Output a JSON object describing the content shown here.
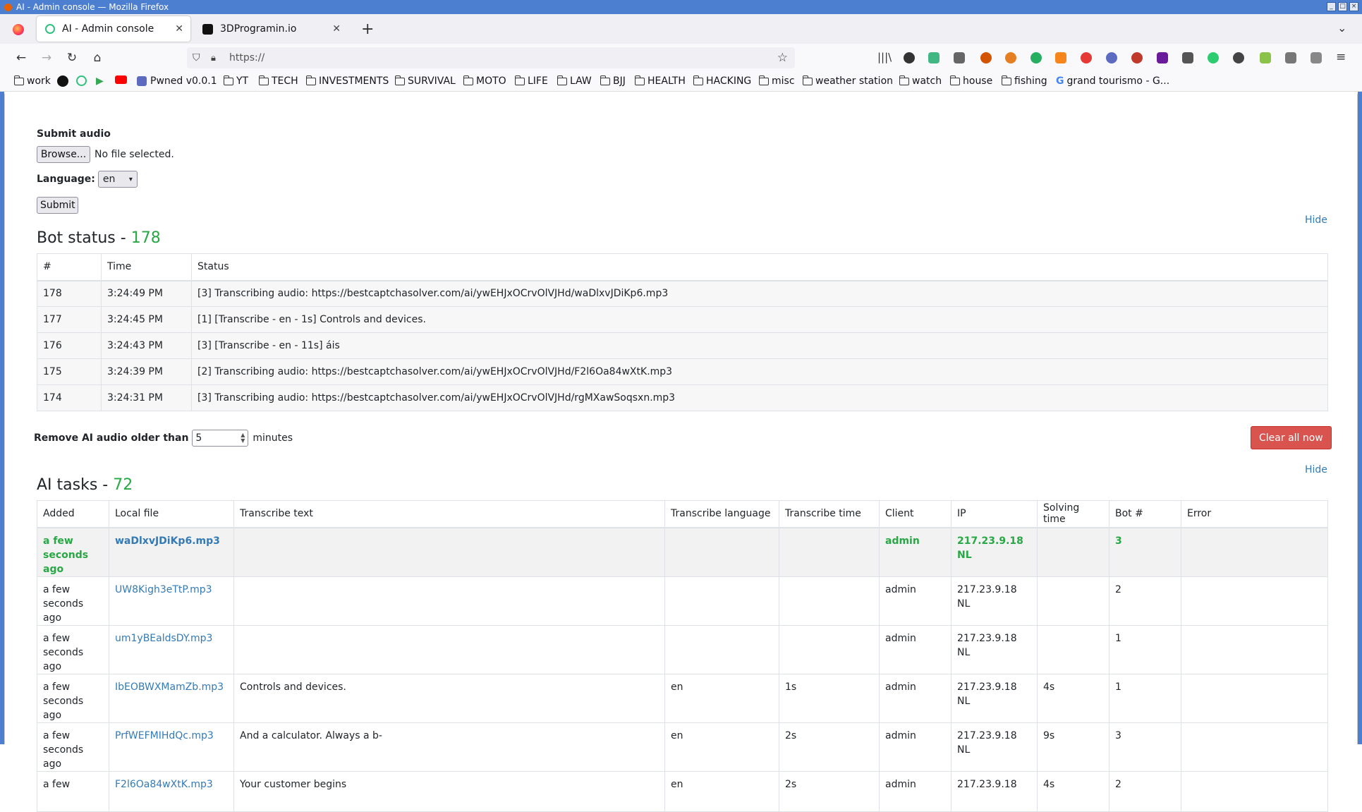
{
  "window": {
    "title": "AI - Admin console — Mozilla Firefox"
  },
  "tabs": [
    {
      "label": "AI - Admin console",
      "active": true
    },
    {
      "label": "3DProgramin.io",
      "active": false
    }
  ],
  "nav": {
    "url": "https://"
  },
  "bookmarks": [
    {
      "label": "work",
      "kind": "folder"
    },
    {
      "label": "",
      "kind": "github-icon"
    },
    {
      "label": "",
      "kind": "c-icon"
    },
    {
      "label": "",
      "kind": "play-icon"
    },
    {
      "label": "",
      "kind": "youtube-icon"
    },
    {
      "label": "Pwned v0.0.1",
      "kind": "app"
    },
    {
      "label": "YT",
      "kind": "folder"
    },
    {
      "label": "TECH",
      "kind": "folder"
    },
    {
      "label": "INVESTMENTS",
      "kind": "folder"
    },
    {
      "label": "SURVIVAL",
      "kind": "folder"
    },
    {
      "label": "MOTO",
      "kind": "folder"
    },
    {
      "label": "LIFE",
      "kind": "folder"
    },
    {
      "label": "LAW",
      "kind": "folder"
    },
    {
      "label": "BJJ",
      "kind": "folder"
    },
    {
      "label": "HEALTH",
      "kind": "folder"
    },
    {
      "label": "HACKING",
      "kind": "folder"
    },
    {
      "label": "misc",
      "kind": "folder"
    },
    {
      "label": "weather station",
      "kind": "folder"
    },
    {
      "label": "watch",
      "kind": "folder"
    },
    {
      "label": "house",
      "kind": "folder"
    },
    {
      "label": "fishing",
      "kind": "folder"
    },
    {
      "label": "grand tourismo - G...",
      "kind": "google"
    }
  ],
  "upload": {
    "title": "Submit audio",
    "browse_label": "Browse...",
    "no_file": "No file selected.",
    "language_label": "Language:",
    "language_value": "en",
    "submit_label": "Submit"
  },
  "bot_status": {
    "title": "Bot status - ",
    "count": "178",
    "hide_label": "Hide",
    "columns": [
      "#",
      "Time",
      "Status"
    ],
    "rows": [
      {
        "num": "178",
        "time": "3:24:49 PM",
        "status": "[3] Transcribing audio: https://bestcaptchasolver.com/ai/ywEHJxOCrvOlVJHd/waDlxvJDiKp6.mp3"
      },
      {
        "num": "177",
        "time": "3:24:45 PM",
        "status": "[1] [Transcribe - en - 1s] Controls and devices."
      },
      {
        "num": "176",
        "time": "3:24:43 PM",
        "status": "[3] [Transcribe - en - 11s] áis"
      },
      {
        "num": "175",
        "time": "3:24:39 PM",
        "status": "[2] Transcribing audio: https://bestcaptchasolver.com/ai/ywEHJxOCrvOlVJHd/F2l6Oa84wXtK.mp3"
      },
      {
        "num": "174",
        "time": "3:24:31 PM",
        "status": "[3] Transcribing audio: https://bestcaptchasolver.com/ai/ywEHJxOCrvOlVJHd/rgMXawSoqsxn.mp3"
      }
    ]
  },
  "cleanup": {
    "label": "Remove AI audio older than",
    "value": "5",
    "unit": "minutes",
    "clear_label": "Clear all now"
  },
  "ai_tasks": {
    "title": "AI tasks - ",
    "count": "72",
    "hide_label": "Hide",
    "columns": [
      "Added",
      "Local file",
      "Transcribe text",
      "Transcribe language",
      "Transcribe time",
      "Client",
      "IP",
      "Solving time",
      "Bot #",
      "Error"
    ],
    "rows": [
      {
        "added": "a few seconds ago",
        "file": "waDlxvJDiKp6.mp3",
        "text": "",
        "lang": "",
        "ttime": "",
        "client": "admin",
        "ip": "217.23.9.18 NL",
        "stime": "",
        "bot": "3",
        "error": "",
        "highlight": true
      },
      {
        "added": "a few seconds ago",
        "file": "UW8Kigh3eTtP.mp3",
        "text": "",
        "lang": "",
        "ttime": "",
        "client": "admin",
        "ip": "217.23.9.18 NL",
        "stime": "",
        "bot": "2",
        "error": "",
        "highlight": false
      },
      {
        "added": "a few seconds ago",
        "file": "um1yBEaldsDY.mp3",
        "text": "",
        "lang": "",
        "ttime": "",
        "client": "admin",
        "ip": "217.23.9.18 NL",
        "stime": "",
        "bot": "1",
        "error": "",
        "highlight": false
      },
      {
        "added": "a few seconds ago",
        "file": "IbEOBWXMamZb.mp3",
        "text": "Controls and devices.",
        "lang": "en",
        "ttime": "1s",
        "client": "admin",
        "ip": "217.23.9.18 NL",
        "stime": "4s",
        "bot": "1",
        "error": "",
        "highlight": false
      },
      {
        "added": "a few seconds ago",
        "file": "PrfWEFMIHdQc.mp3",
        "text": "And a calculator. Always a b-",
        "lang": "en",
        "ttime": "2s",
        "client": "admin",
        "ip": "217.23.9.18 NL",
        "stime": "9s",
        "bot": "3",
        "error": "",
        "highlight": false
      },
      {
        "added": "a few",
        "file": "F2l6Oa84wXtK.mp3",
        "text": "Your customer begins",
        "lang": "en",
        "ttime": "2s",
        "client": "admin",
        "ip": "217.23.9.18",
        "stime": "4s",
        "bot": "2",
        "error": "",
        "highlight": false
      }
    ]
  },
  "colors": {
    "accent_green": "#28a745",
    "link_blue": "#337ab7",
    "danger": "#d9534f",
    "frame_blue": "#4d7fd1"
  }
}
